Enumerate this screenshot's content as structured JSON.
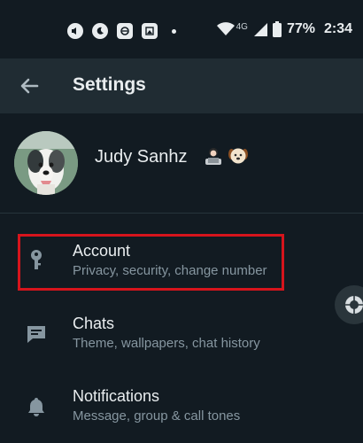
{
  "status_bar": {
    "network": "4G",
    "battery": "77%",
    "time": "2:34"
  },
  "app_bar": {
    "title": "Settings",
    "back_icon": "arrow-left-icon"
  },
  "profile": {
    "name": "Judy Sanhz",
    "emojis": [
      "person-with-laptop",
      "dog-face"
    ]
  },
  "settings": [
    {
      "title": "Account",
      "subtitle": "Privacy, security, change number",
      "icon": "key-icon"
    },
    {
      "title": "Chats",
      "subtitle": "Theme, wallpapers, chat history",
      "icon": "chat-icon"
    },
    {
      "title": "Notifications",
      "subtitle": "Message, group & call tones",
      "icon": "bell-icon"
    }
  ],
  "colors": {
    "background": "#121b22",
    "app_bar": "#202c33",
    "text_primary": "#e9edef",
    "text_secondary": "#8696a0",
    "highlight_border": "#d6141c"
  }
}
